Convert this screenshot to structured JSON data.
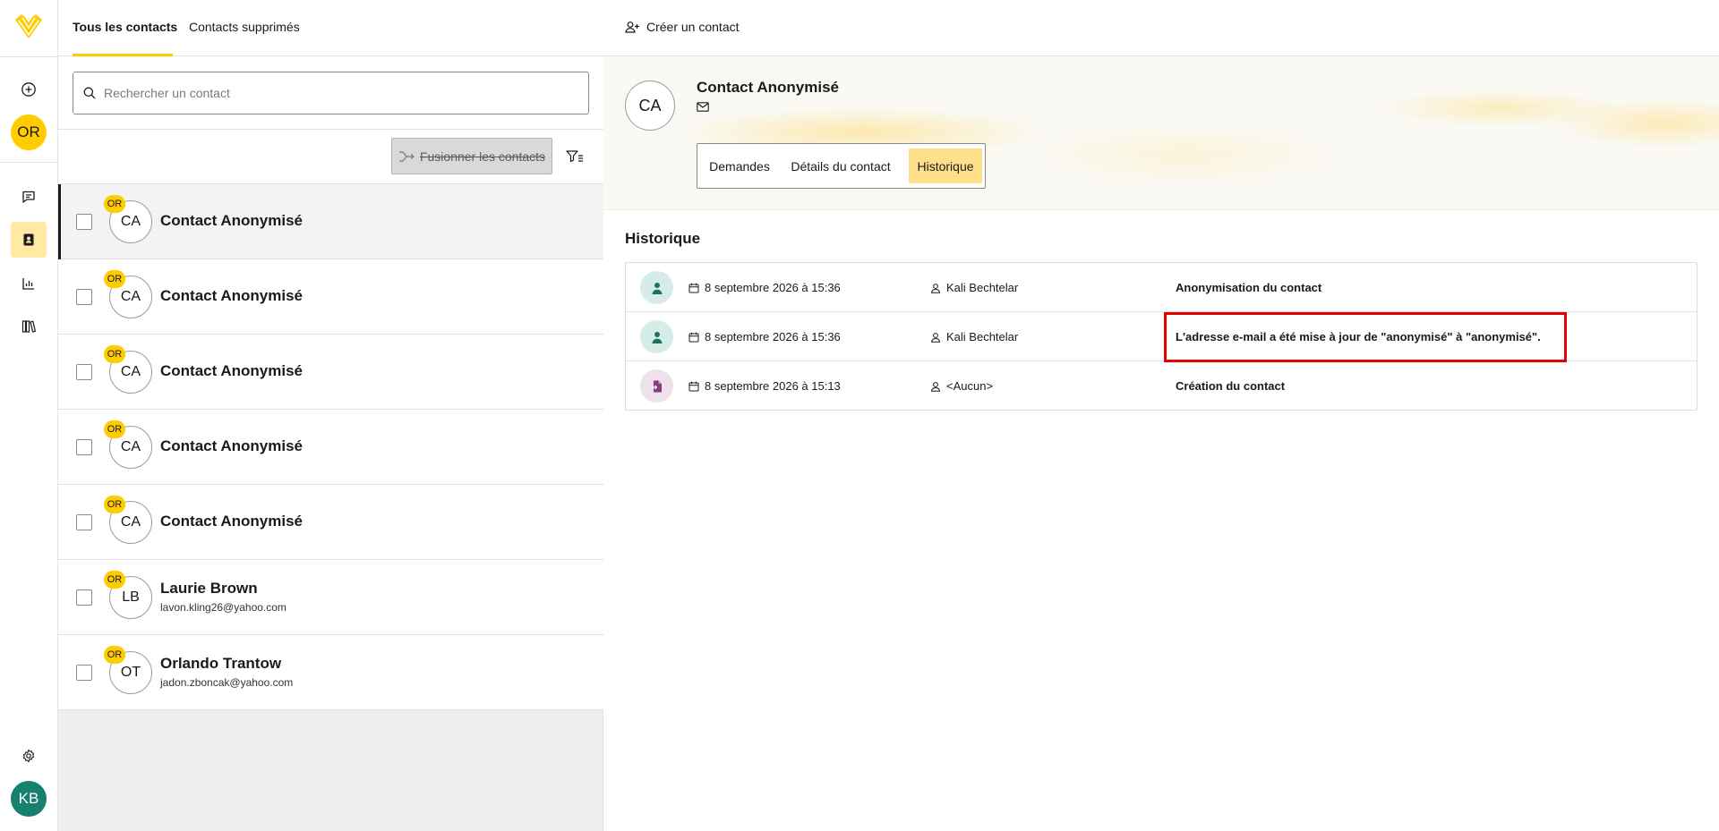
{
  "rail": {
    "org_initials": "OR",
    "user_initials": "KB"
  },
  "list": {
    "tabs": [
      {
        "label": "Tous les contacts",
        "active": true
      },
      {
        "label": "Contacts supprimés",
        "active": false
      }
    ],
    "search_placeholder": "Rechercher un contact",
    "merge_label": "Fusionner les contacts",
    "contacts": [
      {
        "initials": "CA",
        "org": "OR",
        "name": "Contact Anonymisé",
        "email": "",
        "selected": true
      },
      {
        "initials": "CA",
        "org": "OR",
        "name": "Contact Anonymisé",
        "email": "",
        "selected": false
      },
      {
        "initials": "CA",
        "org": "OR",
        "name": "Contact Anonymisé",
        "email": "",
        "selected": false
      },
      {
        "initials": "CA",
        "org": "OR",
        "name": "Contact Anonymisé",
        "email": "",
        "selected": false
      },
      {
        "initials": "CA",
        "org": "OR",
        "name": "Contact Anonymisé",
        "email": "",
        "selected": false
      },
      {
        "initials": "LB",
        "org": "OR",
        "name": "Laurie Brown",
        "email": "lavon.kling26@yahoo.com",
        "selected": false
      },
      {
        "initials": "OT",
        "org": "OR",
        "name": "Orlando Trantow",
        "email": "jadon.zboncak@yahoo.com",
        "selected": false
      }
    ]
  },
  "detail": {
    "create_label": "Créer un contact",
    "contact": {
      "initials": "CA",
      "name": "Contact Anonymisé"
    },
    "segments": [
      {
        "label": "Demandes",
        "active": false
      },
      {
        "label": "Détails du contact",
        "active": false
      },
      {
        "label": "Historique",
        "active": true
      }
    ],
    "history_title": "Historique",
    "history": [
      {
        "icon": "user-icon",
        "date": "8 septembre 2026 à 15:36",
        "author": "Kali Bechtelar",
        "description": "Anonymisation du contact"
      },
      {
        "icon": "user-icon",
        "date": "8 septembre 2026 à 15:36",
        "author": "Kali Bechtelar",
        "description": "L'adresse e-mail a été mise à jour de \"anonymisé\" à \"anonymisé\"."
      },
      {
        "icon": "file-import-icon",
        "date": "8 septembre 2026 à 15:13",
        "author": "<Aucun>",
        "description": "Création du contact"
      }
    ]
  },
  "colors": {
    "accent": "#ffcc00",
    "accent_soft": "#ffe08a",
    "user_avatar": "#17806e",
    "highlight": "#e60000"
  }
}
